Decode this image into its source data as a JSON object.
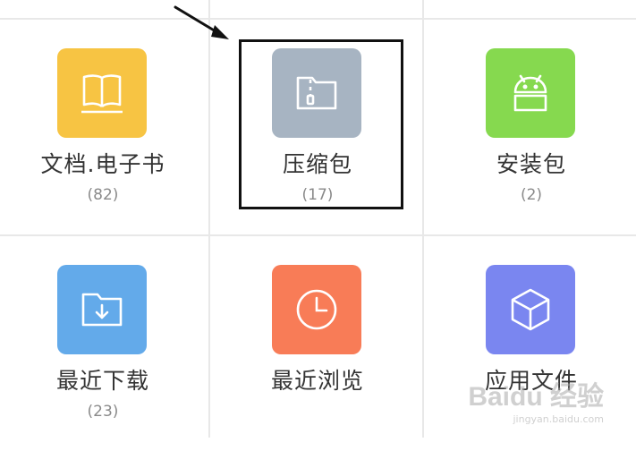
{
  "categories": [
    {
      "name": "文档.电子书",
      "count": "(82)",
      "icon": "book-icon",
      "color": "#f7c443"
    },
    {
      "name": "压缩包",
      "count": "(17)",
      "icon": "zip-folder-icon",
      "color": "#a7b4c2"
    },
    {
      "name": "安装包",
      "count": "(2)",
      "icon": "android-icon",
      "color": "#86d94f"
    },
    {
      "name": "最近下载",
      "count": "(23)",
      "icon": "download-folder-icon",
      "color": "#63aaea"
    },
    {
      "name": "最近浏览",
      "count": "",
      "icon": "clock-icon",
      "color": "#f87c57"
    },
    {
      "name": "应用文件",
      "count": "",
      "icon": "cube-icon",
      "color": "#7a86f0"
    }
  ],
  "watermark": {
    "main": "Baidu 经验",
    "sub": "jingyan.baidu.com"
  }
}
